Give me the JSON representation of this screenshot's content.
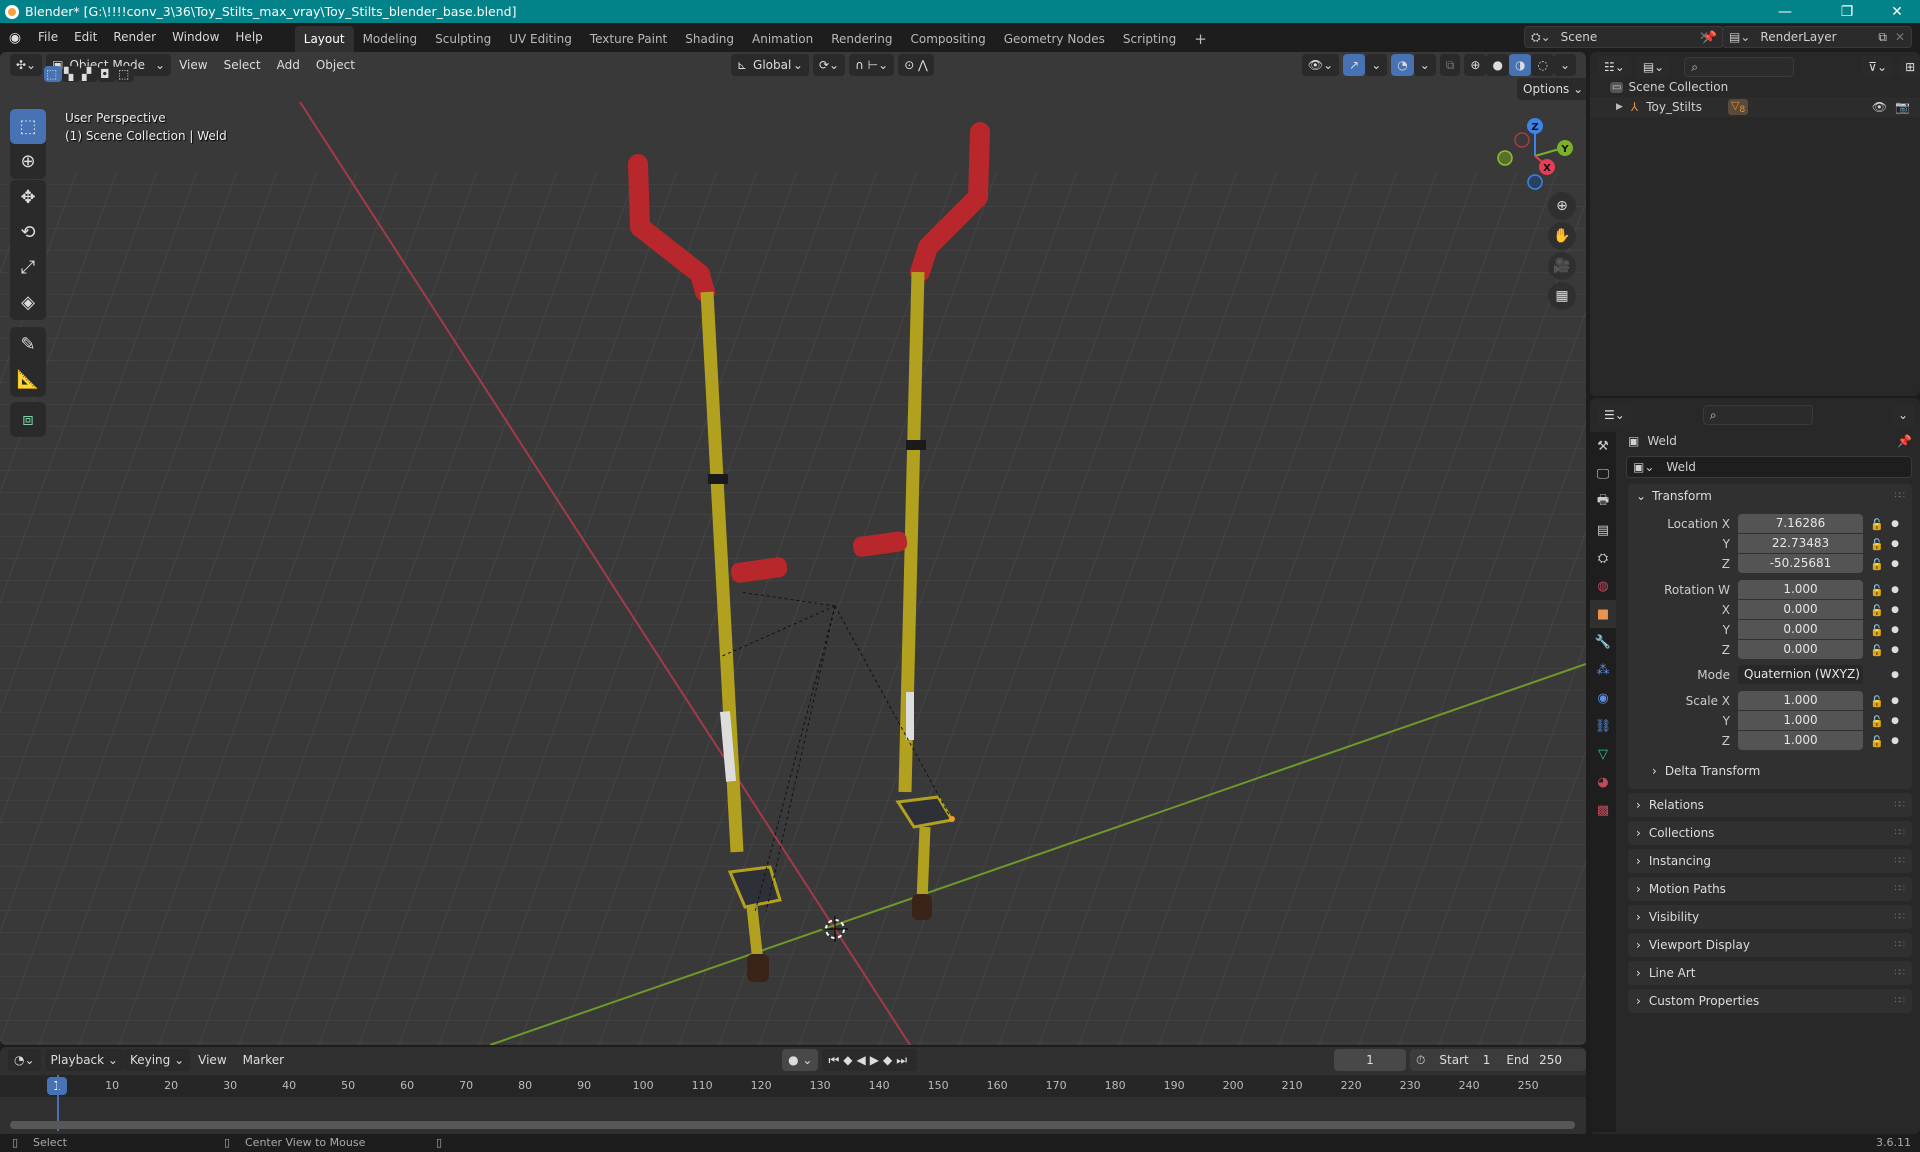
{
  "titlebar": {
    "title": "Blender* [G:\\!!!!conv_3\\36\\Toy_Stilts_max_vray\\Toy_Stilts_blender_base.blend]",
    "minimize": "—",
    "maximize": "❐",
    "close": "✕"
  },
  "menu": {
    "items": [
      "File",
      "Edit",
      "Render",
      "Window",
      "Help"
    ]
  },
  "workspaces": [
    "Layout",
    "Modeling",
    "Sculpting",
    "UV Editing",
    "Texture Paint",
    "Shading",
    "Animation",
    "Rendering",
    "Compositing",
    "Geometry Nodes",
    "Scripting"
  ],
  "active_workspace": "Layout",
  "add_workspace": "+",
  "scene": {
    "name": "Scene",
    "render_layer": "RenderLayer"
  },
  "viewport": {
    "mode": "Object Mode",
    "menus": [
      "View",
      "Select",
      "Add",
      "Object"
    ],
    "orientation": "Global",
    "options_label": "Options",
    "overlay_title": "User Perspective",
    "overlay_subtitle": "(1) Scene Collection | Weld",
    "gizmo": {
      "z": "Z",
      "y": "Y",
      "x": "X"
    }
  },
  "outliner": {
    "root": "Scene Collection",
    "items": [
      {
        "name": "Toy_Stilts",
        "badge": "8"
      }
    ]
  },
  "properties": {
    "object_name": "Weld",
    "data_name": "Weld",
    "transform": {
      "title": "Transform",
      "location": {
        "label": "Location X",
        "x": "7.16286",
        "y": "22.73483",
        "z": "-50.25681"
      },
      "rotation": {
        "label": "Rotation W",
        "w": "1.000",
        "x": "0.000",
        "y": "0.000",
        "z": "0.000"
      },
      "mode_label": "Mode",
      "mode_value": "Quaternion (WXYZ)",
      "scale": {
        "label": "Scale X",
        "x": "1.000",
        "y": "1.000",
        "z": "1.000"
      },
      "axis_y": "Y",
      "axis_z": "Z",
      "axis_x": "X",
      "delta": "Delta Transform"
    },
    "panels": [
      "Relations",
      "Collections",
      "Instancing",
      "Motion Paths",
      "Visibility",
      "Viewport Display",
      "Line Art",
      "Custom Properties"
    ]
  },
  "timeline": {
    "menus": [
      "Playback",
      "Keying",
      "View",
      "Marker"
    ],
    "current_frame": "1",
    "start_label": "Start",
    "start": "1",
    "end_label": "End",
    "end": "250",
    "ticks": [
      "10",
      "20",
      "30",
      "40",
      "50",
      "60",
      "70",
      "80",
      "90",
      "100",
      "110",
      "120",
      "130",
      "140",
      "150",
      "160",
      "170",
      "180",
      "190",
      "200",
      "210",
      "220",
      "230",
      "240",
      "250"
    ]
  },
  "status": {
    "select": "Select",
    "center": "Center View to Mouse",
    "version": "3.6.11"
  }
}
